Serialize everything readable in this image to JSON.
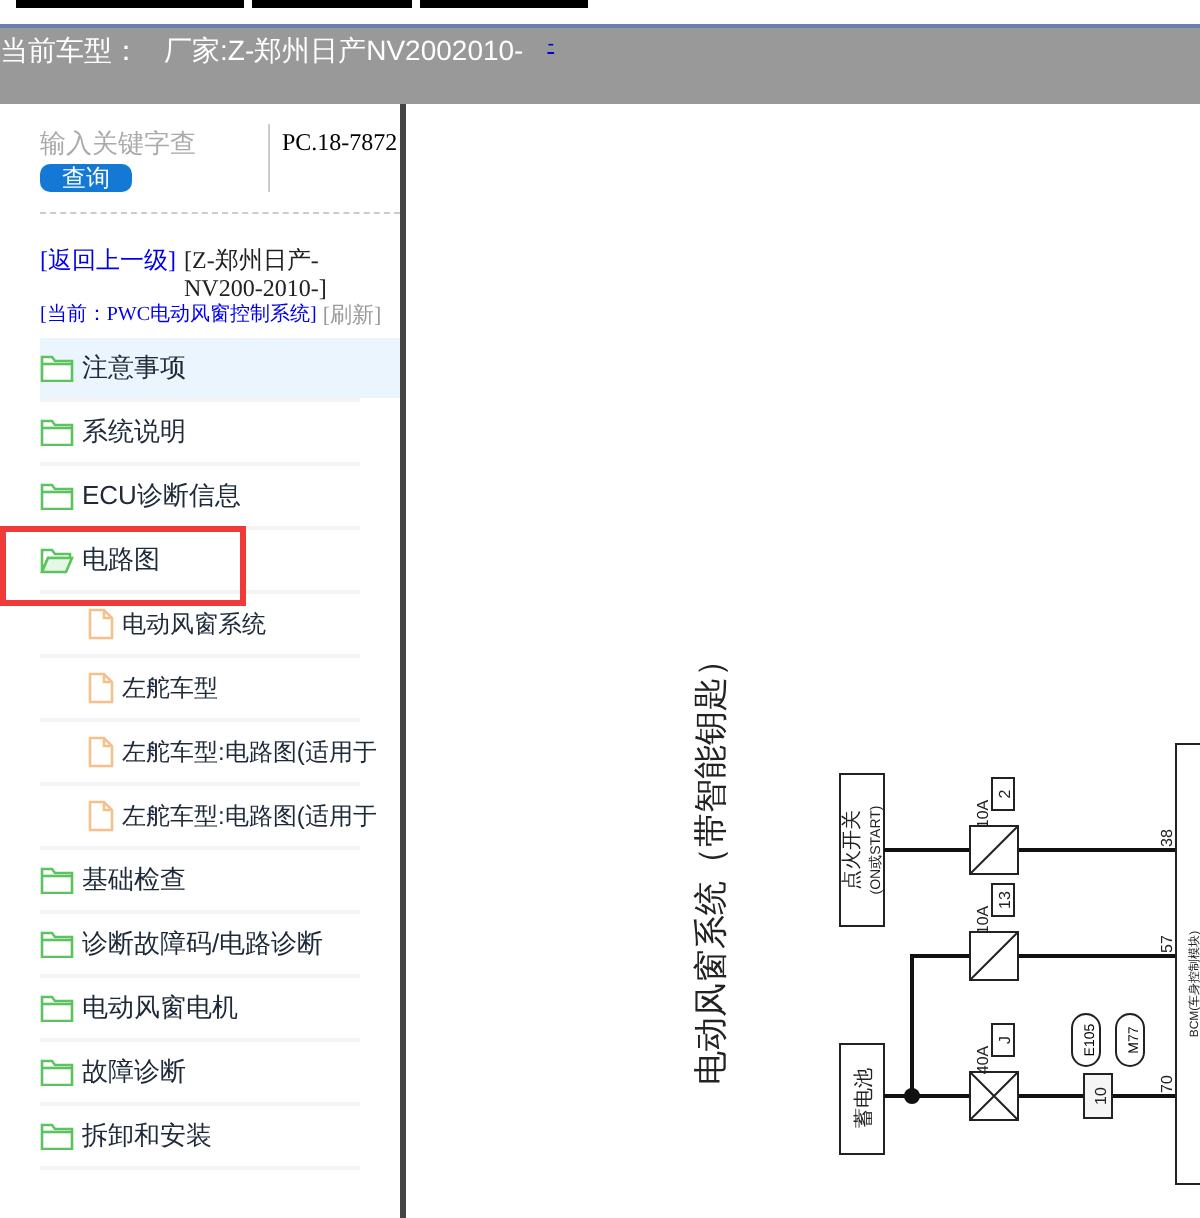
{
  "header": {
    "label": "当前车型：",
    "vehicle": "厂家:Z-郑州日产NV2002010-",
    "link": "-"
  },
  "search": {
    "placeholder": "输入关键字查",
    "button": "查询",
    "code": "PC.18-7872"
  },
  "breadcrumb": {
    "back": "[返回上一级]",
    "parent": "[Z-郑州日产-NV200-2010-]",
    "current": "[当前：PWC电动风窗控制系统]",
    "refresh": "[刷新]"
  },
  "tree": [
    {
      "kind": "folder",
      "label": "注意事项",
      "selected": true,
      "expanded": false,
      "highlighted": false
    },
    {
      "kind": "folder",
      "label": "系统说明",
      "selected": false,
      "expanded": false,
      "highlighted": false
    },
    {
      "kind": "folder",
      "label": "ECU诊断信息",
      "selected": false,
      "expanded": false,
      "highlighted": false
    },
    {
      "kind": "folder",
      "label": "电路图",
      "selected": false,
      "expanded": true,
      "highlighted": true,
      "children": [
        {
          "kind": "doc",
          "label": "电动风窗系统"
        },
        {
          "kind": "doc",
          "label": "左舵车型"
        },
        {
          "kind": "doc",
          "label": "左舵车型:电路图(适用于"
        },
        {
          "kind": "doc",
          "label": "左舵车型:电路图(适用于"
        }
      ]
    },
    {
      "kind": "folder",
      "label": "基础检查",
      "selected": false,
      "expanded": false,
      "highlighted": false
    },
    {
      "kind": "folder",
      "label": "诊断故障码/电路诊断",
      "selected": false,
      "expanded": false,
      "highlighted": false
    },
    {
      "kind": "folder",
      "label": "电动风窗电机",
      "selected": false,
      "expanded": false,
      "highlighted": false
    },
    {
      "kind": "folder",
      "label": "故障诊断",
      "selected": false,
      "expanded": false,
      "highlighted": false
    },
    {
      "kind": "folder",
      "label": "拆卸和安装",
      "selected": false,
      "expanded": false,
      "highlighted": false
    }
  ],
  "diagram": {
    "title": "电动风窗系统（带智能钥匙）",
    "ignition": "点火开关",
    "ignition_note": "(ON或START)",
    "battery": "蓄电池",
    "fuses": [
      {
        "rating": "10A",
        "number": "2",
        "pin": "38"
      },
      {
        "rating": "10A",
        "number": "13",
        "pin": "57"
      },
      {
        "rating": "40A",
        "number": "J",
        "pin": "70"
      }
    ],
    "connectors": [
      "E105",
      "M77"
    ],
    "connector_pin": "10",
    "module": "BCM(车身控制模块)"
  }
}
